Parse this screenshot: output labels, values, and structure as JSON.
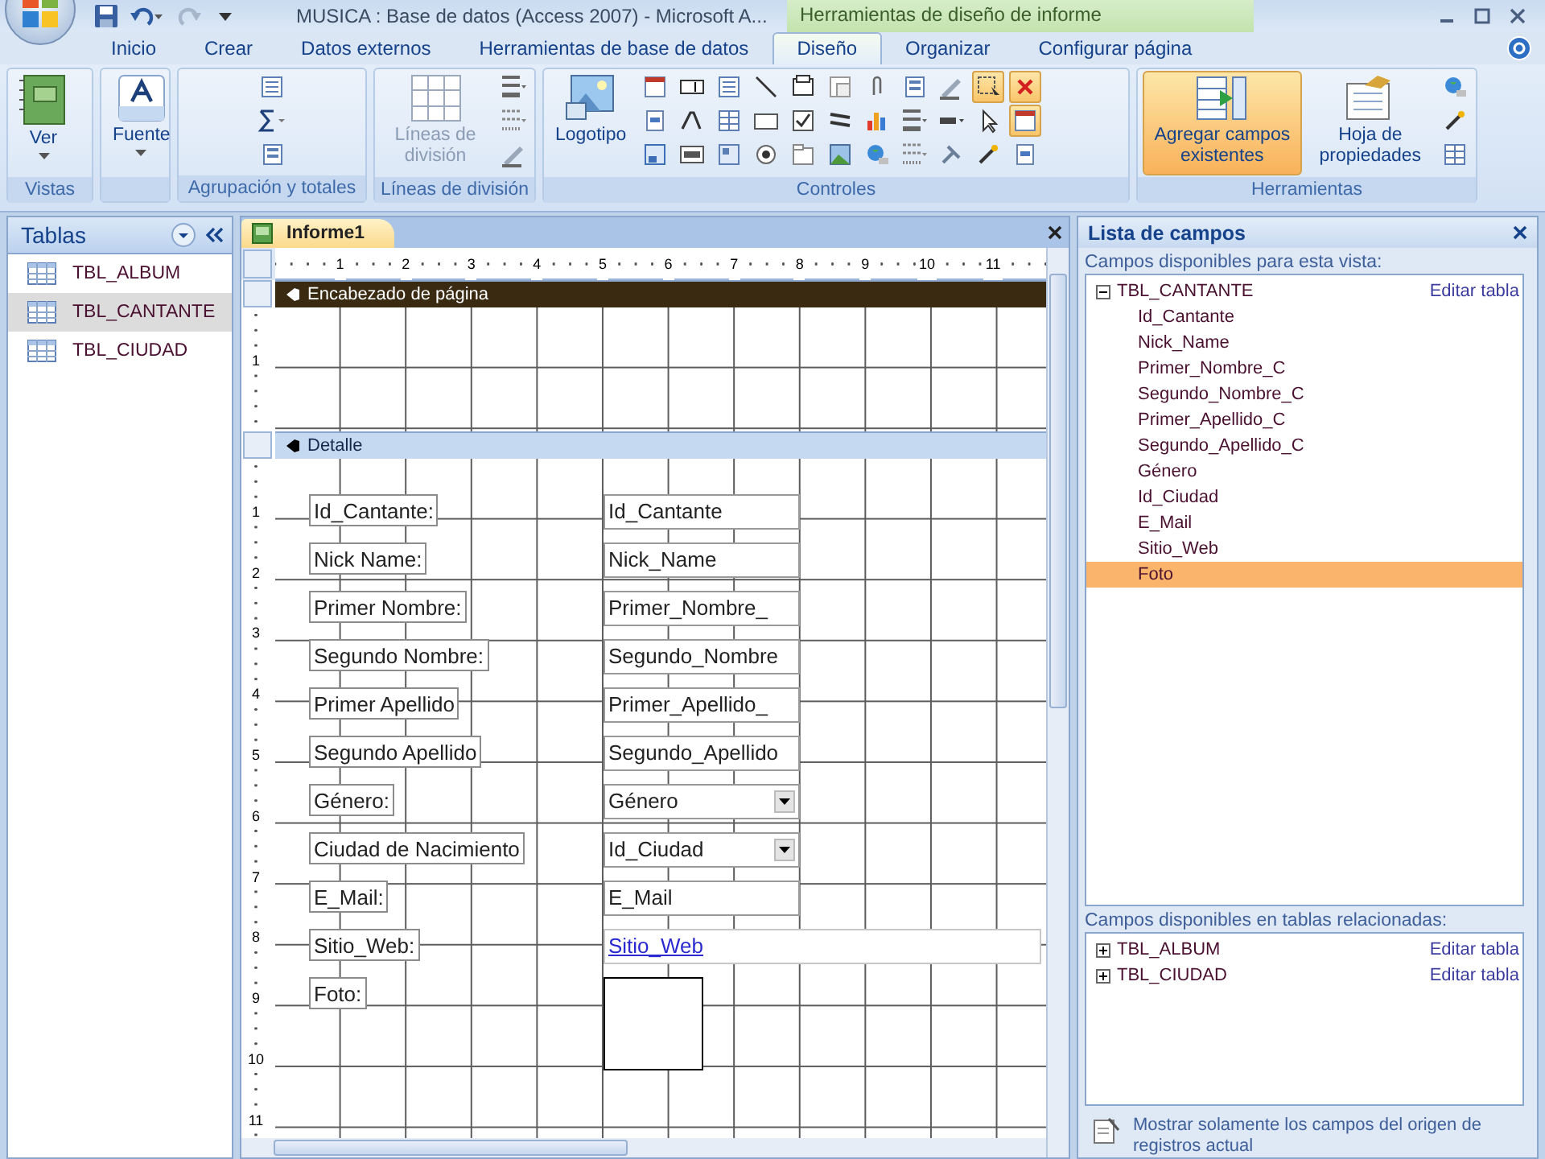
{
  "title_bar": {
    "title": "MUSICA : Base de datos (Access 2007) - Microsoft A...",
    "context_label": "Herramientas de diseño de informe"
  },
  "tabs": [
    {
      "label": "Inicio",
      "selected": false
    },
    {
      "label": "Crear",
      "selected": false
    },
    {
      "label": "Datos externos",
      "selected": false
    },
    {
      "label": "Herramientas de base de datos",
      "selected": false
    },
    {
      "label": "Diseño",
      "selected": true
    },
    {
      "label": "Organizar",
      "selected": false
    },
    {
      "label": "Configurar página",
      "selected": false
    }
  ],
  "ribbon": {
    "groups": [
      {
        "label": "Vistas",
        "buttons": [
          {
            "label": "Ver",
            "selected": false,
            "disabled": false
          }
        ]
      },
      {
        "buttons": [
          {
            "label": "Fuente",
            "selected": false,
            "disabled": false
          }
        ]
      },
      {
        "label": "Agrupación y totales"
      },
      {
        "label": "Líneas de división",
        "buttons": [
          {
            "label": "Líneas de división",
            "selected": false,
            "disabled": true
          }
        ]
      },
      {
        "label": "Controles",
        "buttons": [
          {
            "label": "Logotipo",
            "selected": false,
            "disabled": false
          }
        ],
        "tools": [
          {
            "selected": false
          },
          {
            "selected": false
          },
          {
            "selected": false
          },
          {
            "selected": false
          },
          {
            "selected": false
          },
          {
            "selected": false
          },
          {
            "selected": false
          },
          {
            "selected": false
          },
          {
            "selected": false
          },
          {
            "selected": false
          },
          {
            "selected": false
          },
          {
            "selected": false
          },
          {
            "selected": false
          },
          {
            "selected": false
          },
          {
            "selected": false
          },
          {
            "selected": false
          },
          {
            "selected": false
          },
          {
            "selected": false
          },
          {
            "selected": false
          },
          {
            "selected": false
          },
          {
            "selected": false
          },
          {
            "selected": false
          },
          {
            "selected": false
          },
          {
            "selected": false
          },
          {
            "selected": false
          },
          {
            "selected": false
          },
          {
            "selected": false
          },
          {
            "selected": true
          },
          {
            "selected": false
          },
          {
            "selected": false
          },
          {
            "selected": true
          },
          {
            "selected": true
          },
          {
            "selected": false
          }
        ]
      },
      {
        "label": "Herramientas",
        "buttons": [
          {
            "label": "Agregar campos existentes",
            "selected": true,
            "disabled": false
          },
          {
            "label": "Hoja de propiedades",
            "selected": false,
            "disabled": false
          }
        ]
      }
    ]
  },
  "nav_pane": {
    "title": "Tablas",
    "items": [
      {
        "label": "TBL_ALBUM",
        "selected": false
      },
      {
        "label": "TBL_CANTANTE",
        "selected": true
      },
      {
        "label": "TBL_CIUDAD",
        "selected": false
      }
    ]
  },
  "document": {
    "tab": "Informe1",
    "ruler": [
      "1",
      "2",
      "3",
      "4",
      "5",
      "6",
      "7",
      "8",
      "9",
      "10",
      "11"
    ],
    "sections": [
      {
        "title": "Encabezado de página",
        "selected": true,
        "ruler": [
          "1"
        ]
      },
      {
        "title": "Detalle",
        "selected": false,
        "ruler": [
          "1",
          "2",
          "3",
          "4",
          "5",
          "6",
          "7",
          "8",
          "9",
          "10",
          "11"
        ],
        "controls": [
          {
            "label": "Id_Cantante:",
            "kind": "text",
            "field": "Id_Cantante"
          },
          {
            "label": "Nick Name:",
            "kind": "text",
            "field": "Nick_Name"
          },
          {
            "label": "Primer Nombre:",
            "kind": "text",
            "field": "Primer_Nombre_"
          },
          {
            "label": "Segundo Nombre:",
            "kind": "text",
            "field": "Segundo_Nombre"
          },
          {
            "label": "Primer Apellido",
            "kind": "text",
            "field": "Primer_Apellido_"
          },
          {
            "label": "Segundo Apellido",
            "kind": "text",
            "field": "Segundo_Apellido"
          },
          {
            "label": "Género:",
            "kind": "combo",
            "field": "Género"
          },
          {
            "label": "Ciudad de Nacimiento",
            "kind": "combo",
            "field": "Id_Ciudad"
          },
          {
            "label": "E_Mail:",
            "kind": "text",
            "field": "E_Mail"
          },
          {
            "label": "Sitio_Web:",
            "kind": "link",
            "field": "Sitio_Web"
          },
          {
            "label": "Foto:",
            "kind": "image"
          }
        ]
      }
    ]
  },
  "field_list": {
    "title": "Lista de campos",
    "available_label": "Campos disponibles para esta vista:",
    "tables": [
      {
        "name": "TBL_CANTANTE",
        "expanded": true,
        "action": "Editar tabla",
        "children": [
          {
            "name": "Id_Cantante",
            "selected": false
          },
          {
            "name": "Nick_Name",
            "selected": false
          },
          {
            "name": "Primer_Nombre_C",
            "selected": false
          },
          {
            "name": "Segundo_Nombre_C",
            "selected": false
          },
          {
            "name": "Primer_Apellido_C",
            "selected": false
          },
          {
            "name": "Segundo_Apellido_C",
            "selected": false
          },
          {
            "name": "Género",
            "selected": false
          },
          {
            "name": "Id_Ciudad",
            "selected": false
          },
          {
            "name": "E_Mail",
            "selected": false
          },
          {
            "name": "Sitio_Web",
            "selected": false
          },
          {
            "name": "Foto",
            "selected": true
          }
        ]
      }
    ],
    "related_label": "Campos disponibles en tablas relacionadas:",
    "related_tables": [
      {
        "name": "TBL_ALBUM",
        "expanded": false,
        "action": "Editar tabla"
      },
      {
        "name": "TBL_CIUDAD",
        "expanded": false,
        "action": "Editar tabla"
      }
    ],
    "footer": "Mostrar solamente los campos del origen de registros actual"
  }
}
